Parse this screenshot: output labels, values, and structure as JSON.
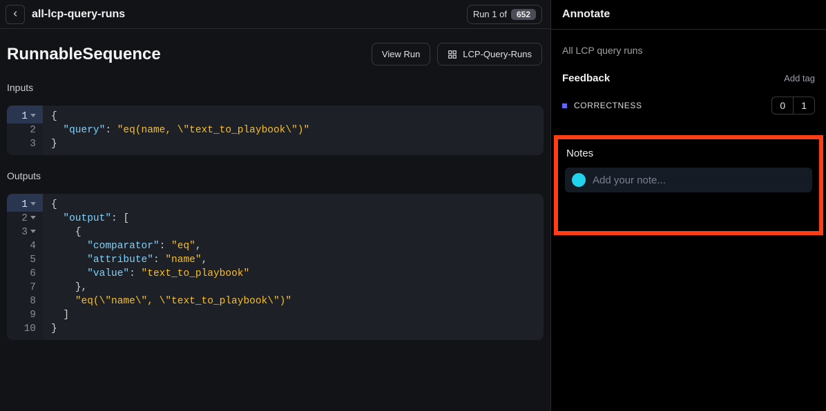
{
  "header": {
    "breadcrumb": "all-lcp-query-runs",
    "run_of_label": "Run 1 of",
    "total_runs": "652"
  },
  "title_row": {
    "page_title": "RunnableSequence",
    "view_run_label": "View Run",
    "tag_button_label": "LCP-Query-Runs"
  },
  "inputs": {
    "section_label": "Inputs",
    "code": [
      {
        "n": "1",
        "fold": true,
        "tokens": [
          [
            "{",
            "brace"
          ]
        ]
      },
      {
        "n": "2",
        "fold": false,
        "tokens": [
          [
            "  ",
            ""
          ],
          [
            "\"query\"",
            "key"
          ],
          [
            ": ",
            "punc"
          ],
          [
            "\"eq(name, \\\"text_to_playbook\\\")\"",
            "str"
          ]
        ]
      },
      {
        "n": "3",
        "fold": false,
        "tokens": [
          [
            "}",
            "brace"
          ]
        ]
      }
    ]
  },
  "outputs": {
    "section_label": "Outputs",
    "code": [
      {
        "n": "1",
        "fold": true,
        "tokens": [
          [
            "{",
            "brace"
          ]
        ]
      },
      {
        "n": "2",
        "fold": true,
        "tokens": [
          [
            "  ",
            ""
          ],
          [
            "\"output\"",
            "key"
          ],
          [
            ": ",
            "punc"
          ],
          [
            "[",
            "brace"
          ]
        ]
      },
      {
        "n": "3",
        "fold": true,
        "tokens": [
          [
            "    ",
            ""
          ],
          [
            "{",
            "brace"
          ]
        ]
      },
      {
        "n": "4",
        "fold": false,
        "tokens": [
          [
            "      ",
            ""
          ],
          [
            "\"comparator\"",
            "key"
          ],
          [
            ": ",
            "punc"
          ],
          [
            "\"eq\"",
            "str"
          ],
          [
            ",",
            "punc"
          ]
        ]
      },
      {
        "n": "5",
        "fold": false,
        "tokens": [
          [
            "      ",
            ""
          ],
          [
            "\"attribute\"",
            "key"
          ],
          [
            ": ",
            "punc"
          ],
          [
            "\"name\"",
            "str"
          ],
          [
            ",",
            "punc"
          ]
        ]
      },
      {
        "n": "6",
        "fold": false,
        "tokens": [
          [
            "      ",
            ""
          ],
          [
            "\"value\"",
            "key"
          ],
          [
            ": ",
            "punc"
          ],
          [
            "\"text_to_playbook\"",
            "str"
          ]
        ]
      },
      {
        "n": "7",
        "fold": false,
        "tokens": [
          [
            "    ",
            ""
          ],
          [
            "}",
            "brace"
          ],
          [
            ",",
            "punc"
          ]
        ]
      },
      {
        "n": "8",
        "fold": false,
        "tokens": [
          [
            "    ",
            ""
          ],
          [
            "\"eq(\\\"name\\\", \\\"text_to_playbook\\\")\"",
            "str"
          ]
        ]
      },
      {
        "n": "9",
        "fold": false,
        "tokens": [
          [
            "  ",
            ""
          ],
          [
            "]",
            "brace"
          ]
        ]
      },
      {
        "n": "10",
        "fold": false,
        "tokens": [
          [
            "}",
            "brace"
          ]
        ]
      }
    ]
  },
  "sidebar": {
    "title": "Annotate",
    "subtitle": "All LCP query runs",
    "feedback_label": "Feedback",
    "add_tag_label": "Add tag",
    "correctness_label": "CORRECTNESS",
    "score_0": "0",
    "score_1": "1",
    "notes_label": "Notes",
    "note_placeholder": "Add your note..."
  }
}
